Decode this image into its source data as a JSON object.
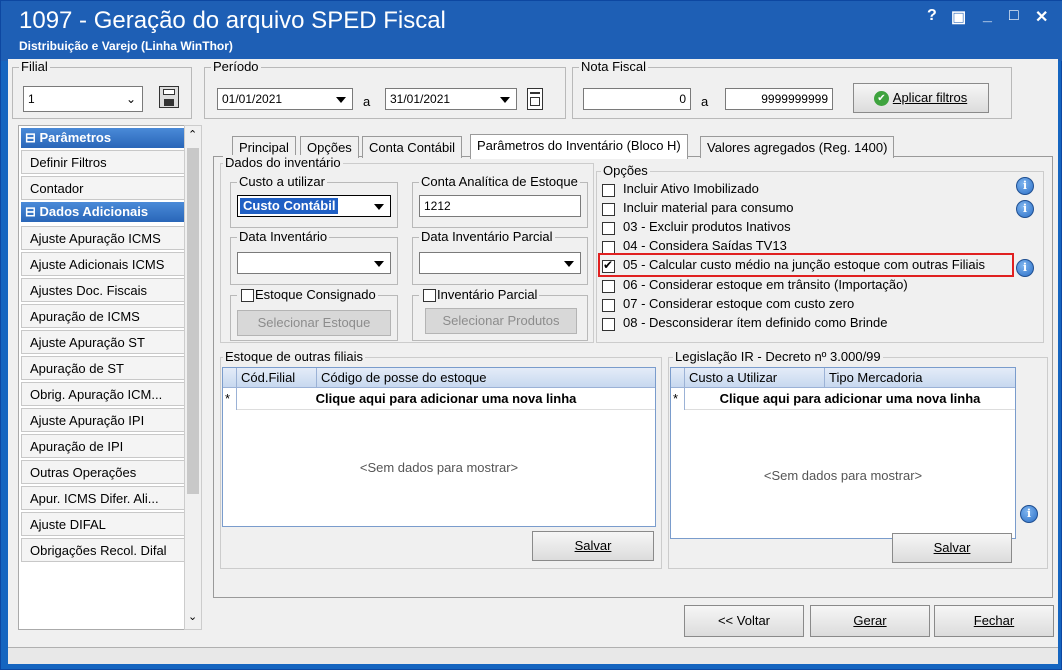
{
  "window": {
    "title": "1097 - Geração do arquivo SPED Fiscal",
    "subtitle": "Distribuição e Varejo (Linha WinThor)",
    "controls": [
      "?",
      "▣",
      "_",
      "□",
      "✕"
    ]
  },
  "filters": {
    "filial_label": "Filial",
    "filial_value": "1",
    "periodo_label": "Período",
    "periodo_start": "01/01/2021",
    "periodo_a": "a",
    "periodo_end": "31/01/2021",
    "nota_label": "Nota Fiscal",
    "nota_start": "0",
    "nota_a": "a",
    "nota_end": "9999999999",
    "apply_label": "Aplicar filtros"
  },
  "sidebar": {
    "header1": "Parâmetros",
    "header2": "Dados Adicionais",
    "items": [
      "Definir Filtros",
      "Contador",
      "Ajuste Apuração ICMS",
      "Ajuste Adicionais ICMS",
      "Ajustes Doc. Fiscais",
      "Apuração de ICMS",
      "Ajuste Apuração ST",
      "Apuração de ST",
      "Obrig. Apuração ICM...",
      "Ajuste Apuração IPI",
      "Apuração de IPI",
      "Outras Operações",
      "Apur. ICMS Difer. Ali...",
      "Ajuste DIFAL",
      "Obrigações Recol. Difal"
    ]
  },
  "tabs": [
    "Principal",
    "Opções",
    "Conta Contábil",
    "Parâmetros do Inventário (Bloco H)",
    "Valores agregados (Reg. 1400)"
  ],
  "inventario": {
    "group_label": "Dados do inventário",
    "custo_label": "Custo a utilizar",
    "custo_value": "Custo Contábil",
    "conta_label": "Conta Analítica de Estoque",
    "conta_value": "1212",
    "data_inv_label": "Data Inventário",
    "data_inv_parcial_label": "Data Inventário Parcial",
    "estoque_consignado_label": "Estoque Consignado",
    "selecionar_estoque_label": "Selecionar Estoque",
    "inv_parcial_label": "Inventário Parcial",
    "selecionar_produtos_label": "Selecionar Produtos"
  },
  "opcoes": {
    "label": "Opções",
    "items": [
      {
        "text": "Incluir Ativo Imobilizado",
        "checked": false
      },
      {
        "text": "Incluir material para consumo",
        "checked": false
      },
      {
        "text": "03 - Excluir produtos Inativos",
        "checked": false
      },
      {
        "text": "04 - Considera Saídas TV13",
        "checked": false
      },
      {
        "text": "05 - Calcular custo médio na junção estoque com outras Filiais",
        "checked": true
      },
      {
        "text": "06 - Considerar estoque em trânsito (Importação)",
        "checked": false
      },
      {
        "text": "07 - Considerar estoque com custo zero",
        "checked": false
      },
      {
        "text": "08 - Desconsiderar ítem definido como Brinde",
        "checked": false
      }
    ],
    "highlight_color": "#e02020"
  },
  "estoque_filiais": {
    "label": "Estoque de outras filiais",
    "col1": "Cód.Filial",
    "col2": "Código de posse do estoque",
    "add_row": "Clique aqui para adicionar uma nova linha",
    "nodata": "<Sem dados para mostrar>",
    "row_marker": "*",
    "save": "Salvar"
  },
  "legislacao": {
    "label": "Legislação IR - Decreto nº 3.000/99",
    "col1": "Custo a Utilizar",
    "col2": "Tipo Mercadoria",
    "add_row": "Clique aqui para adicionar uma nova linha",
    "nodata": "<Sem dados para mostrar>",
    "row_marker": "*",
    "save": "Salvar"
  },
  "footer": {
    "voltar": "<< Voltar",
    "gerar": "Gerar",
    "fechar": "Fechar"
  },
  "info_icon_glyph": "i"
}
